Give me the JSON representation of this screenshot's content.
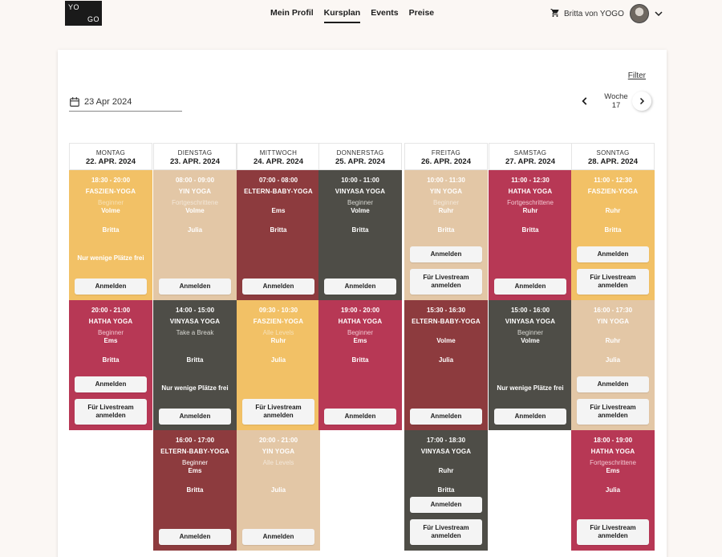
{
  "logo": {
    "line1": "YO",
    "line2": "GO"
  },
  "nav": [
    "Mein Profil",
    "Kursplan",
    "Events",
    "Preise"
  ],
  "user": {
    "name": "Britta von YOGO",
    "cart_icon": "cart-icon",
    "avatar_icon": "avatar"
  },
  "filter_label": "Filter",
  "date_value": "23 Apr 2024",
  "week": {
    "label": "Woche",
    "number": "17"
  },
  "colors": {
    "yellow": "#f2c166",
    "beige": "#e3c7a6",
    "maroon": "#8d3b3e",
    "dark": "#4e4d47",
    "pink": "#b73855"
  },
  "days": [
    {
      "name": "MONTAG",
      "date": "22. APR. 2024"
    },
    {
      "name": "DIENSTAG",
      "date": "23. APR. 2024"
    },
    {
      "name": "MITTWOCH",
      "date": "24. APR. 2024"
    },
    {
      "name": "DONNERSTAG",
      "date": "25. APR. 2024"
    },
    {
      "name": "FREITAG",
      "date": "26. APR. 2024"
    },
    {
      "name": "SAMSTAG",
      "date": "27. APR. 2024"
    },
    {
      "name": "SONNTAG",
      "date": "28. APR. 2024"
    }
  ],
  "classes": [
    {
      "day": 0,
      "row": 0,
      "color": "yel",
      "time": "18:30 - 20:00",
      "name": "FASZIEN-YOGA",
      "level": "Beginner",
      "location": "Volme",
      "teacher": "Britta",
      "note": "Nur wenige Plätze frei",
      "buttons": [
        "Anmelden"
      ]
    },
    {
      "day": 1,
      "row": 0,
      "color": "bei",
      "time": "08:00 - 09:00",
      "name": "YIN YOGA",
      "level": "Fortgeschrittene",
      "location": "Volme",
      "teacher": "Julia",
      "note": "",
      "buttons": [
        "Anmelden"
      ]
    },
    {
      "day": 2,
      "row": 0,
      "color": "red",
      "time": "07:00 - 08:00",
      "name": "ELTERN-BABY-YOGA",
      "level": "",
      "location": "Ems",
      "teacher": "Britta",
      "note": "",
      "buttons": [
        "Anmelden"
      ]
    },
    {
      "day": 3,
      "row": 0,
      "color": "dk",
      "time": "10:00 - 11:00",
      "name": "VINYASA YOGA",
      "level": "Beginner",
      "location": "Volme",
      "teacher": "Britta",
      "note": "",
      "buttons": [
        "Anmelden"
      ]
    },
    {
      "day": 4,
      "row": 0,
      "color": "bei",
      "time": "10:00 - 11:30",
      "name": "YIN YOGA",
      "level": "Beginner",
      "location": "Ruhr",
      "teacher": "Britta",
      "note": "",
      "buttons": [
        "Anmelden",
        "Für Livestream anmelden"
      ]
    },
    {
      "day": 5,
      "row": 0,
      "color": "pink",
      "time": "11:00 - 12:30",
      "name": "HATHA YOGA",
      "level": "Fortgeschrittene",
      "location": "Ruhr",
      "teacher": "Britta",
      "note": "",
      "buttons": [
        "Anmelden"
      ]
    },
    {
      "day": 6,
      "row": 0,
      "color": "yel",
      "time": "11:00 - 12:30",
      "name": "FASZIEN-YOGA",
      "level": "",
      "location": "Ruhr",
      "teacher": "Britta",
      "note": "",
      "buttons": [
        "Anmelden",
        "Für Livestream anmelden"
      ]
    },
    {
      "day": 0,
      "row": 1,
      "color": "pink",
      "time": "20:00 - 21:00",
      "name": "HATHA YOGA",
      "level": "Beginner",
      "location": "Ems",
      "teacher": "Britta",
      "note": "",
      "buttons": [
        "Anmelden",
        "Für Livestream anmelden"
      ]
    },
    {
      "day": 1,
      "row": 1,
      "color": "dk",
      "time": "14:00 - 15:00",
      "name": "VINYASA YOGA",
      "level": "Take a Break",
      "location": "",
      "teacher": "Britta",
      "note": "Nur wenige Plätze frei",
      "buttons": [
        "Anmelden"
      ]
    },
    {
      "day": 2,
      "row": 1,
      "color": "yel",
      "time": "09:30 - 10:30",
      "name": "FASZIEN-YOGA",
      "level": "Alle Levels",
      "location": "Ruhr",
      "teacher": "Julia",
      "note": "",
      "buttons": [
        "Für Livestream anmelden"
      ]
    },
    {
      "day": 3,
      "row": 1,
      "color": "pink",
      "time": "19:00 - 20:00",
      "name": "HATHA YOGA",
      "level": "Beginner",
      "location": "Ems",
      "teacher": "Britta",
      "note": "",
      "buttons": [
        "Anmelden"
      ]
    },
    {
      "day": 4,
      "row": 1,
      "color": "red",
      "time": "15:30 - 16:30",
      "name": "ELTERN-BABY-YOGA",
      "level": "",
      "location": "Volme",
      "teacher": "Julia",
      "note": "",
      "buttons": [
        "Anmelden"
      ]
    },
    {
      "day": 5,
      "row": 1,
      "color": "dk",
      "time": "15:00 - 16:00",
      "name": "VINYASA YOGA",
      "level": "Beginner",
      "location": "Volme",
      "teacher": "",
      "note": "Nur wenige Plätze frei",
      "buttons": [
        "Anmelden"
      ]
    },
    {
      "day": 6,
      "row": 1,
      "color": "bei",
      "time": "16:00 - 17:30",
      "name": "YIN YOGA",
      "level": "",
      "location": "Ruhr",
      "teacher": "Julia",
      "note": "",
      "buttons": [
        "Anmelden",
        "Für Livestream anmelden"
      ]
    },
    {
      "day": 1,
      "row": 2,
      "color": "red",
      "time": "16:00 - 17:00",
      "name": "ELTERN-BABY-YOGA",
      "level": "Beginner",
      "location": "Ems",
      "teacher": "Britta",
      "note": "",
      "buttons": [
        "Anmelden"
      ]
    },
    {
      "day": 2,
      "row": 2,
      "color": "bei",
      "time": "20:00 - 21:00",
      "name": "YIN YOGA",
      "level": "Alle Levels",
      "location": "",
      "teacher": "Julia",
      "note": "",
      "buttons": [
        "Anmelden"
      ]
    },
    {
      "day": 4,
      "row": 2,
      "color": "dk",
      "time": "17:00 - 18:30",
      "name": "VINYASA YOGA",
      "level": "",
      "location": "Ruhr",
      "teacher": "Britta",
      "note": "",
      "buttons": [
        "Anmelden",
        "Für Livestream anmelden"
      ]
    },
    {
      "day": 6,
      "row": 2,
      "color": "pink",
      "time": "18:00 - 19:00",
      "name": "HATHA YOGA",
      "level": "Fortgeschrittene",
      "location": "Ems",
      "teacher": "Julia",
      "note": "",
      "buttons": [
        "Für Livestream anmelden"
      ]
    }
  ]
}
